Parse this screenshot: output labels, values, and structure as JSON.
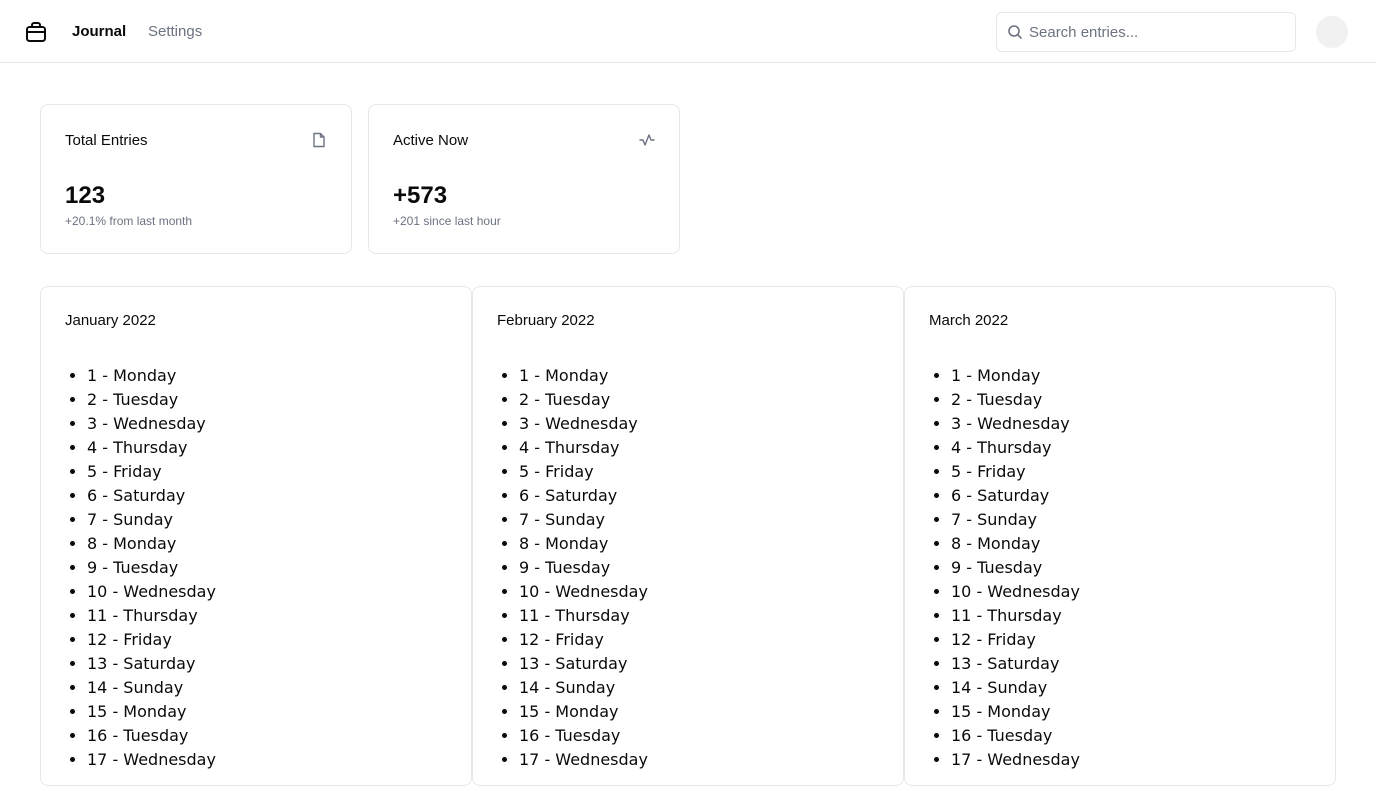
{
  "header": {
    "logo_icon": "briefcase-icon",
    "nav": [
      {
        "label": "Journal",
        "active": true
      },
      {
        "label": "Settings",
        "active": false
      }
    ],
    "search": {
      "placeholder": "Search entries...",
      "value": ""
    }
  },
  "stats": [
    {
      "title": "Total Entries",
      "icon": "document-icon",
      "value": "123",
      "subtitle": "+20.1% from last month"
    },
    {
      "title": "Active Now",
      "icon": "activity-icon",
      "value": "+573",
      "subtitle": "+201 since last hour"
    }
  ],
  "months": [
    {
      "title": "January 2022",
      "days": [
        "1 - Monday",
        "2 - Tuesday",
        "3 - Wednesday",
        "4 - Thursday",
        "5 - Friday",
        "6 - Saturday",
        "7 - Sunday",
        "8 - Monday",
        "9 - Tuesday",
        "10 - Wednesday",
        "11 - Thursday",
        "12 - Friday",
        "13 - Saturday",
        "14 - Sunday",
        "15 - Monday",
        "16 - Tuesday",
        "17 - Wednesday"
      ]
    },
    {
      "title": "February 2022",
      "days": [
        "1 - Monday",
        "2 - Tuesday",
        "3 - Wednesday",
        "4 - Thursday",
        "5 - Friday",
        "6 - Saturday",
        "7 - Sunday",
        "8 - Monday",
        "9 - Tuesday",
        "10 - Wednesday",
        "11 - Thursday",
        "12 - Friday",
        "13 - Saturday",
        "14 - Sunday",
        "15 - Monday",
        "16 - Tuesday",
        "17 - Wednesday"
      ]
    },
    {
      "title": "March 2022",
      "days": [
        "1 - Monday",
        "2 - Tuesday",
        "3 - Wednesday",
        "4 - Thursday",
        "5 - Friday",
        "6 - Saturday",
        "7 - Sunday",
        "8 - Monday",
        "9 - Tuesday",
        "10 - Wednesday",
        "11 - Thursday",
        "12 - Friday",
        "13 - Saturday",
        "14 - Sunday",
        "15 - Monday",
        "16 - Tuesday",
        "17 - Wednesday"
      ]
    }
  ]
}
